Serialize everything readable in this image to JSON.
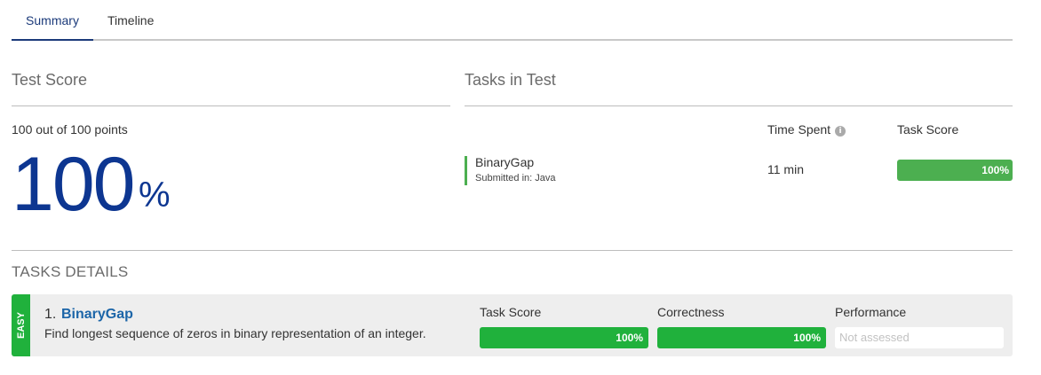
{
  "tabs": [
    {
      "label": "Summary",
      "active": true
    },
    {
      "label": "Timeline",
      "active": false
    }
  ],
  "test_score": {
    "title": "Test Score",
    "points_text": "100 out of 100 points",
    "percent": "100",
    "percent_sign": "%"
  },
  "tasks_in_test": {
    "title": "Tasks in Test",
    "time_spent_label": "Time Spent",
    "task_score_label": "Task Score",
    "info_icon": "info-icon",
    "tasks": [
      {
        "name": "BinaryGap",
        "submitted_in": "Submitted in: Java",
        "time": "11 min",
        "score_text": "100%",
        "score_fraction": 1.0
      }
    ]
  },
  "tasks_details": {
    "title": "TASKS DETAILS",
    "items": [
      {
        "difficulty": "EASY",
        "number": "1.",
        "name": "BinaryGap",
        "description": "Find longest sequence of zeros in binary representation of an integer.",
        "metrics": [
          {
            "label": "Task Score",
            "value": "100%",
            "fraction": 1.0
          },
          {
            "label": "Correctness",
            "value": "100%",
            "fraction": 1.0
          },
          {
            "label": "Performance",
            "value": "Not assessed",
            "fraction": null
          }
        ]
      }
    ]
  },
  "colors": {
    "accent_blue": "#0d3691",
    "link_blue": "#1c65a8",
    "success_green": "#20b13c",
    "bar_green": "#4caf50"
  }
}
